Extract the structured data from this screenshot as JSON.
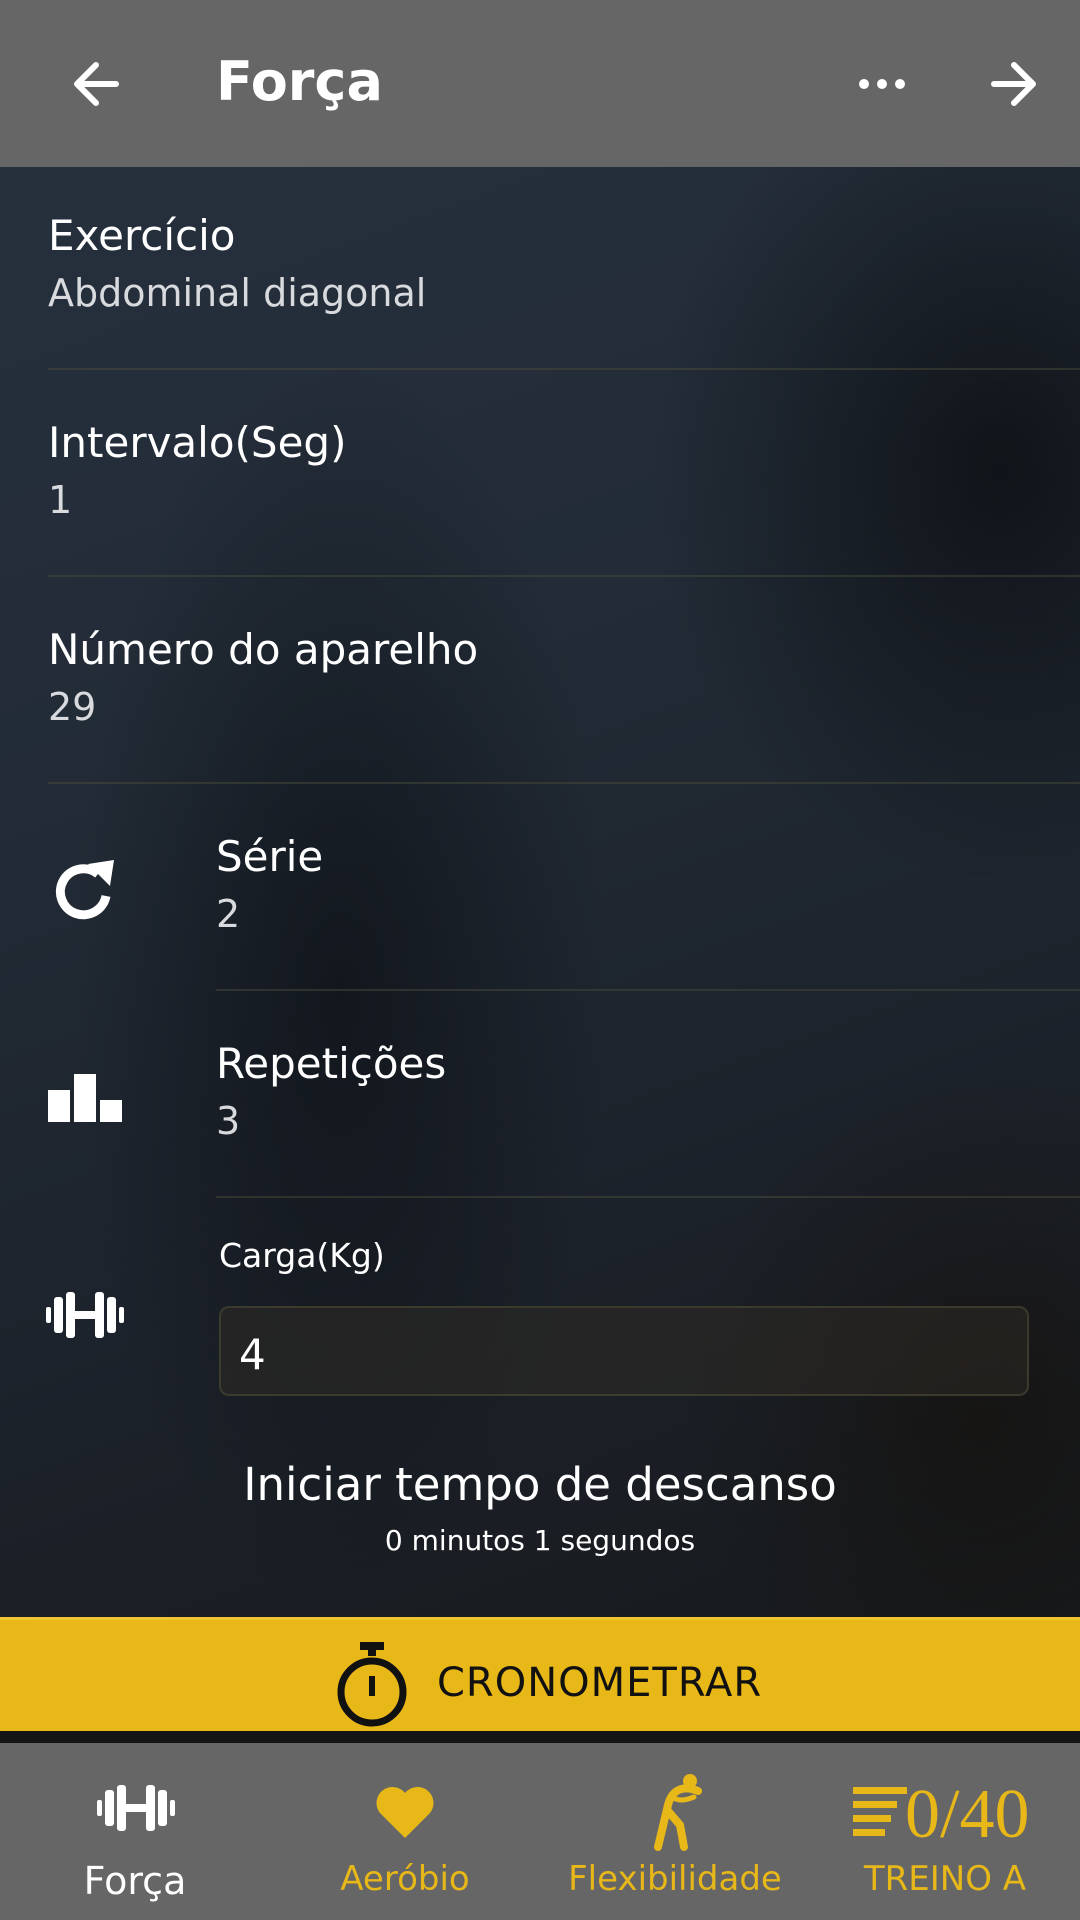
{
  "header": {
    "title": "Força",
    "back_icon": "arrow-left-icon",
    "more_icon": "more-horizontal-icon",
    "forward_icon": "arrow-right-icon"
  },
  "fields": {
    "exercicio": {
      "label": "Exercício",
      "value": "Abdominal diagonal"
    },
    "intervalo": {
      "label": "Intervalo(Seg)",
      "value": "1"
    },
    "aparelho": {
      "label": "Número do aparelho",
      "value": "29"
    },
    "serie": {
      "label": "Série",
      "value": "2",
      "icon": "refresh-icon"
    },
    "repeticoes": {
      "label": "Repetições",
      "value": "3",
      "icon": "bar-chart-icon"
    },
    "carga": {
      "label": "Carga(Kg)",
      "value": "4",
      "icon": "dumbbell-icon"
    }
  },
  "rest": {
    "title": "Iniciar tempo de descanso",
    "subtitle": "0 minutos 1 segundos"
  },
  "crono": {
    "label": "CRONOMETRAR",
    "icon": "stopwatch-icon"
  },
  "bottom_nav": {
    "items": [
      {
        "label": "Força",
        "icon": "dumbbell-icon",
        "active": true
      },
      {
        "label": "Aeróbio",
        "icon": "heart-icon",
        "active": false
      },
      {
        "label": "Flexibilidade",
        "icon": "stretching-icon",
        "active": false
      },
      {
        "label": "TREINO A",
        "icon": "list-icon",
        "counter": "0/40",
        "active": false
      }
    ]
  },
  "colors": {
    "accent": "#e8b718",
    "bar": "#666666",
    "text": "#ffffff"
  }
}
